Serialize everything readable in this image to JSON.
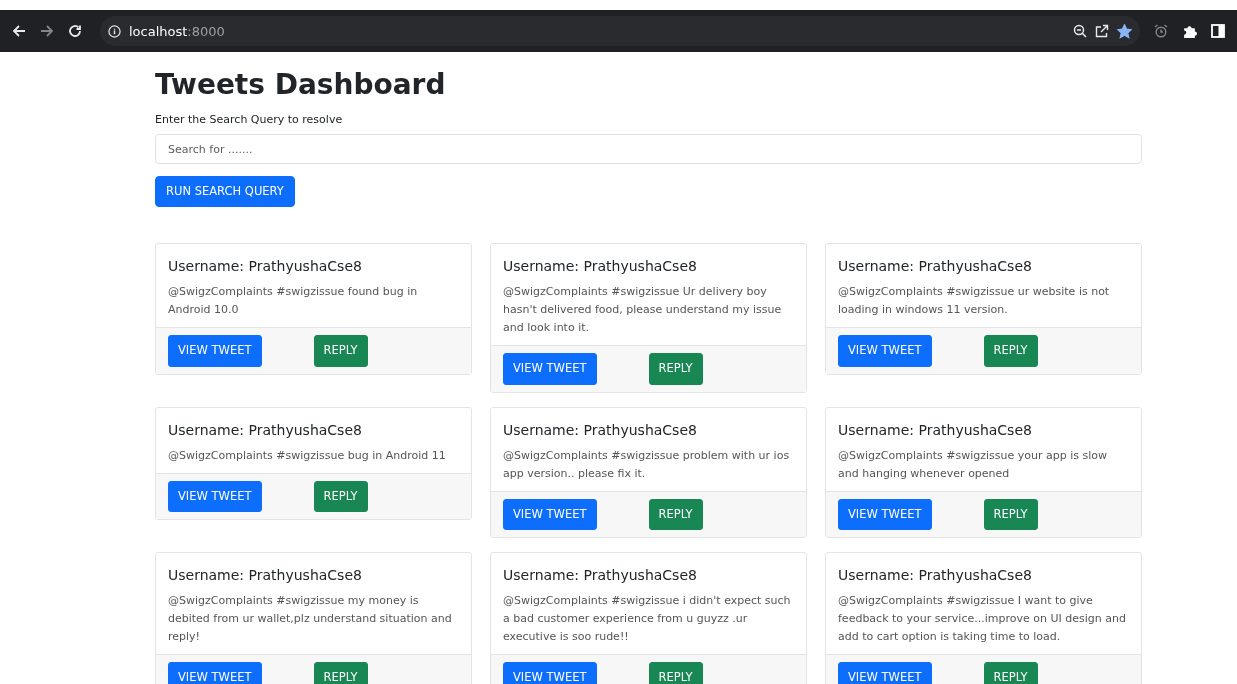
{
  "browser": {
    "url_host": "localhost",
    "url_port": ":8000",
    "bookmarked": true
  },
  "page": {
    "title": "Tweets Dashboard",
    "search_label": "Enter the Search Query to resolve",
    "search": {
      "placeholder": "Search for ......."
    },
    "search_button": "RUN SEARCH QUERY"
  },
  "tweets": [
    {
      "username": "Username: PrathyushaCse8",
      "text": "@SwigzComplaints #swigzissue found bug in Android 10.0",
      "buttons": [
        "VIEW TWEET",
        "REPLY"
      ]
    },
    {
      "username": "Username: PrathyushaCse8",
      "text": "@SwigzComplaints #swigzissue Ur delivery boy hasn't delivered food, please understand my issue and look into it.",
      "buttons": [
        "VIEW TWEET",
        "REPLY"
      ]
    },
    {
      "username": "Username: PrathyushaCse8",
      "text": "@SwigzComplaints #swigzissue ur website is not loading in windows 11 version.",
      "buttons": [
        "VIEW TWEET",
        "REPLY"
      ]
    },
    {
      "username": "Username: PrathyushaCse8",
      "text": "@SwigzComplaints #swigzissue bug in Android 11",
      "buttons": [
        "VIEW TWEET",
        "REPLY"
      ]
    },
    {
      "username": "Username: PrathyushaCse8",
      "text": "@SwigzComplaints #swigzissue problem with ur ios app version.. please fix it.",
      "buttons": [
        "VIEW TWEET",
        "REPLY"
      ]
    },
    {
      "username": "Username: PrathyushaCse8",
      "text": "@SwigzComplaints #swigzissue your app is slow and hanging whenever opened",
      "buttons": [
        "VIEW TWEET",
        "REPLY"
      ]
    },
    {
      "username": "Username: PrathyushaCse8",
      "text": "@SwigzComplaints #swigzissue my money is debited from ur wallet,plz understand situation and reply!",
      "buttons": [
        "VIEW TWEET",
        "REPLY"
      ]
    },
    {
      "username": "Username: PrathyushaCse8",
      "text": "@SwigzComplaints #swigzissue i didn't expect such a bad customer experience from u guyzz .ur executive is soo rude!!",
      "buttons": [
        "VIEW TWEET",
        "REPLY"
      ]
    },
    {
      "username": "Username: PrathyushaCse8",
      "text": "@SwigzComplaints #swigzissue I want to give feedback to your service...improve on UI design and add to cart option is taking time to load.",
      "buttons": [
        "VIEW TWEET",
        "REPLY"
      ]
    }
  ]
}
